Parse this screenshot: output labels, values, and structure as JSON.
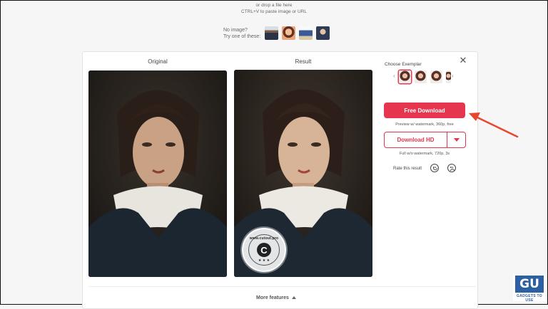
{
  "upload": {
    "drop_hint": "or drop a file here",
    "paste_hint": "CTRL+V to paste image or URL",
    "no_image_label": "No image?",
    "try_label": "Try one of these:"
  },
  "panel": {
    "original_title": "Original",
    "result_title": "Result",
    "exemplar_label": "Choose Exemplar",
    "free_download_label": "Free Download",
    "preview_note": "Preview w/ watermark, 360p, free",
    "download_hd_label": "Download HD",
    "full_note": "Full w/o watermark, 720p, 3s",
    "rate_label": "Rate this result",
    "watermark_text": "www.cutout.pro",
    "watermark_letter": "C",
    "watermark_stars": "★ ★ ★",
    "more_features_label": "More features"
  },
  "logo": {
    "mark": "GU",
    "text": "GADGETS TO USE"
  },
  "icons": {
    "close": "close-icon",
    "prev": "chevron-left-icon",
    "next": "chevron-right-icon",
    "dropdown": "caret-down-icon",
    "happy": "smiley-face-icon",
    "sad": "sad-face-icon",
    "annotation": "red-arrow-icon"
  },
  "colors": {
    "accent": "#e5354f",
    "logo_blue": "#2d5fa3"
  }
}
